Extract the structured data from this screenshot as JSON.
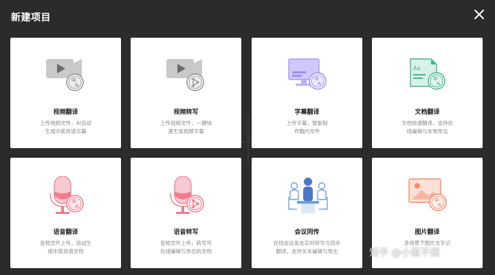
{
  "dialog": {
    "title": "新建项目"
  },
  "cards": [
    {
      "title": "视频翻译",
      "desc": [
        "上传视频文件，AI自动",
        "生成中英双语字幕"
      ]
    },
    {
      "title": "视频转写",
      "desc": [
        "上传视频文件，一键快",
        "速生成视频字幕"
      ]
    },
    {
      "title": "字幕翻译",
      "desc": [
        "上传字幕，智能制",
        "作翻内文件"
      ]
    },
    {
      "title": "文档翻译",
      "desc": [
        "文档快速翻译，支持在",
        "线编辑与本地导出"
      ]
    },
    {
      "title": "语音翻译",
      "desc": [
        "音频文件上传，自动生",
        "成中英双语文档"
      ]
    },
    {
      "title": "语音转写",
      "desc": [
        "音频文件上传，转写可",
        "在线编辑与导出的文档"
      ]
    },
    {
      "title": "会议同传",
      "desc": [
        "在线会议发言实时转写与同步",
        "翻译，支持文本编辑与导出"
      ]
    },
    {
      "title": "图片翻译",
      "desc": [
        "多场景下图片文字识",
        ""
      ]
    }
  ],
  "icon_badge": {
    "zh": "中",
    "a": "A",
    "aa": "Aa"
  },
  "watermark": "知乎 @小董不摆",
  "colors": {
    "background": "#2b2b2b",
    "card": "#ffffff",
    "gray_icon": "#9a9a9a",
    "purple": "#9b8ff0",
    "green": "#3fb68b",
    "pink": "#f07a8e",
    "blue": "#4a78c8",
    "orange": "#f28a6a"
  }
}
